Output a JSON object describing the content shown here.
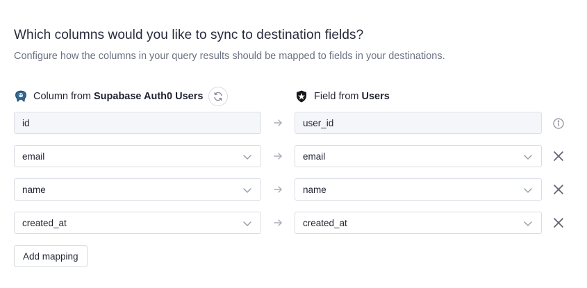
{
  "header": {
    "title": "Which columns would you like to sync to destination fields?",
    "subtitle": "Configure how the columns in your query results should be mapped to fields in your destinations."
  },
  "source_column": {
    "prefix": "Column from",
    "name": "Supabase Auth0 Users",
    "icon": "postgres-elephant-icon"
  },
  "destination_column": {
    "prefix": "Field from",
    "name": "Users",
    "icon": "auth0-shield-icon"
  },
  "mappings": [
    {
      "source": "id",
      "destination": "user_id",
      "locked": true
    },
    {
      "source": "email",
      "destination": "email",
      "locked": false
    },
    {
      "source": "name",
      "destination": "name",
      "locked": false
    },
    {
      "source": "created_at",
      "destination": "created_at",
      "locked": false
    }
  ],
  "actions": {
    "add_mapping_label": "Add mapping"
  },
  "colors": {
    "accent_blue": "#336791",
    "border": "#d9dce3",
    "muted_text": "#6b7080"
  }
}
